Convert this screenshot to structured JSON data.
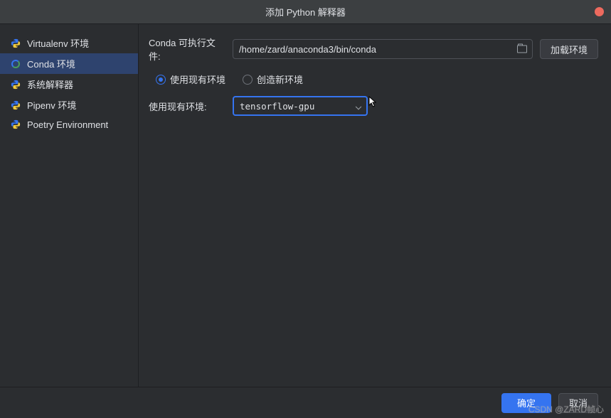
{
  "titlebar": {
    "title": "添加 Python 解释器"
  },
  "sidebar": {
    "items": [
      {
        "label": "Virtualenv 环境"
      },
      {
        "label": "Conda 环境"
      },
      {
        "label": "系统解释器"
      },
      {
        "label": "Pipenv 环境"
      },
      {
        "label": "Poetry Environment"
      }
    ]
  },
  "content": {
    "executable_label": "Conda 可执行文件:",
    "executable_path": "/home/zard/anaconda3/bin/conda",
    "load_button": "加载环境",
    "radio_use_existing": "使用现有环境",
    "radio_create_new": "创造新环境",
    "existing_env_label": "使用现有环境:",
    "selected_env": "tensorflow-gpu"
  },
  "footer": {
    "ok": "确定",
    "cancel": "取消"
  },
  "watermark": "CSDN @ZARD帧心"
}
